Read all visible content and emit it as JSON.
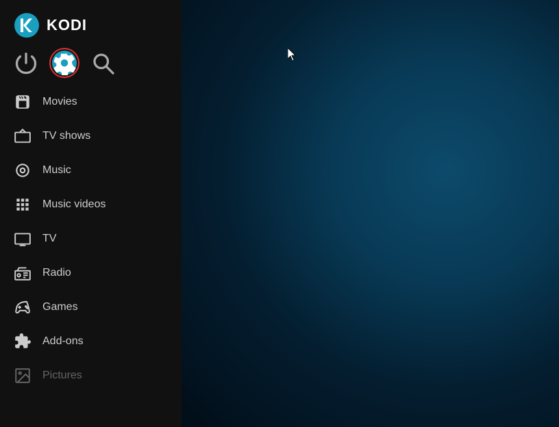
{
  "app": {
    "title": "KODI"
  },
  "toolbar": {
    "power_label": "Power",
    "settings_label": "Settings",
    "search_label": "Search"
  },
  "nav": {
    "items": [
      {
        "id": "movies",
        "label": "Movies",
        "icon": "movies"
      },
      {
        "id": "tv-shows",
        "label": "TV shows",
        "icon": "tv-shows"
      },
      {
        "id": "music",
        "label": "Music",
        "icon": "music"
      },
      {
        "id": "music-videos",
        "label": "Music videos",
        "icon": "music-videos"
      },
      {
        "id": "tv",
        "label": "TV",
        "icon": "tv"
      },
      {
        "id": "radio",
        "label": "Radio",
        "icon": "radio"
      },
      {
        "id": "games",
        "label": "Games",
        "icon": "games"
      },
      {
        "id": "add-ons",
        "label": "Add-ons",
        "icon": "add-ons"
      },
      {
        "id": "pictures",
        "label": "Pictures",
        "icon": "pictures",
        "dim": true
      }
    ]
  }
}
